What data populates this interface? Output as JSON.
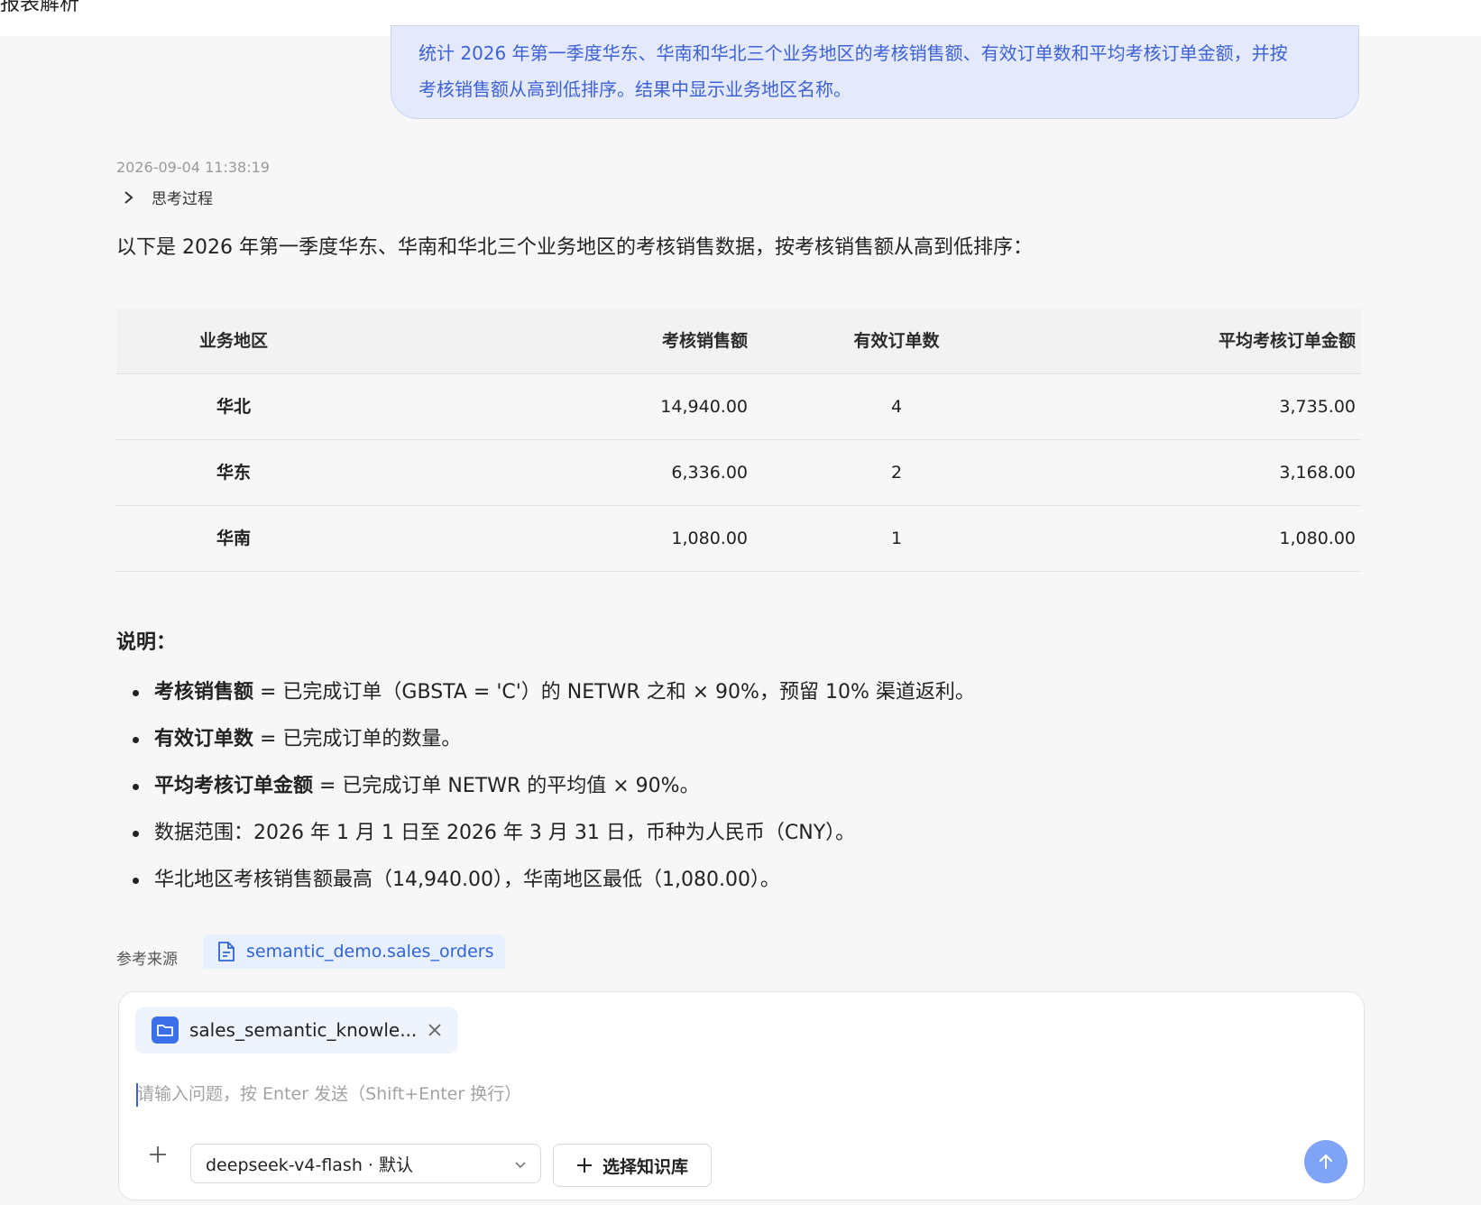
{
  "header": {
    "title": "报表解析"
  },
  "user_message": {
    "line1": "统计 2026 年第一季度华东、华南和华北三个业务地区的考核销售额、有效订单数和平均考核订单金额，并按",
    "line2": "考核销售额从高到低排序。结果中显示业务地区名称。"
  },
  "answer": {
    "timestamp": "2026-09-04 11:38:19",
    "thinking_label": "思考过程",
    "intro": "以下是 2026 年第一季度华东、华南和华北三个业务地区的考核销售数据，按考核销售额从高到低排序：",
    "table": {
      "headers": [
        "业务地区",
        "考核销售额",
        "有效订单数",
        "平均考核订单金额"
      ],
      "rows": [
        [
          "华北",
          "14,940.00",
          "4",
          "3,735.00"
        ],
        [
          "华东",
          "6,336.00",
          "2",
          "3,168.00"
        ],
        [
          "华南",
          "1,080.00",
          "1",
          "1,080.00"
        ]
      ]
    },
    "notes_title": "说明：",
    "notes": [
      {
        "bold": "考核销售额",
        "text": " = 已完成订单（GBSTA = 'C'）的 NETWR 之和 × 90%，预留 10% 渠道返利。"
      },
      {
        "bold": "有效订单数",
        "text": " = 已完成订单的数量。"
      },
      {
        "bold": "平均考核订单金额",
        "text": " = 已完成订单 NETWR 的平均值 × 90%。"
      },
      {
        "bold": "",
        "text": "数据范围：2026 年 1 月 1 日至 2026 年 3 月 31 日，币种为人民币（CNY）。"
      },
      {
        "bold": "",
        "text": "华北地区考核销售额最高（14,940.00），华南地区最低（1,080.00）。"
      }
    ],
    "reference_label": "参考来源",
    "reference": "semantic_demo.sales_orders"
  },
  "composer": {
    "knowledge_chip": "sales_semantic_knowle...",
    "placeholder": "请输入问题，按 Enter 发送（Shift+Enter 换行）",
    "model": "deepseek-v4-flash · 默认",
    "select_kb_label": "选择知识库"
  },
  "colors": {
    "accent": "#3e62d6",
    "send_button": "#7fa3f5",
    "user_bubble": "#e4e9fb"
  },
  "icons": [
    "chevron-right-icon",
    "document-icon",
    "folder-icon",
    "close-icon",
    "plus-icon",
    "chevron-down-icon",
    "arrow-up-icon"
  ]
}
